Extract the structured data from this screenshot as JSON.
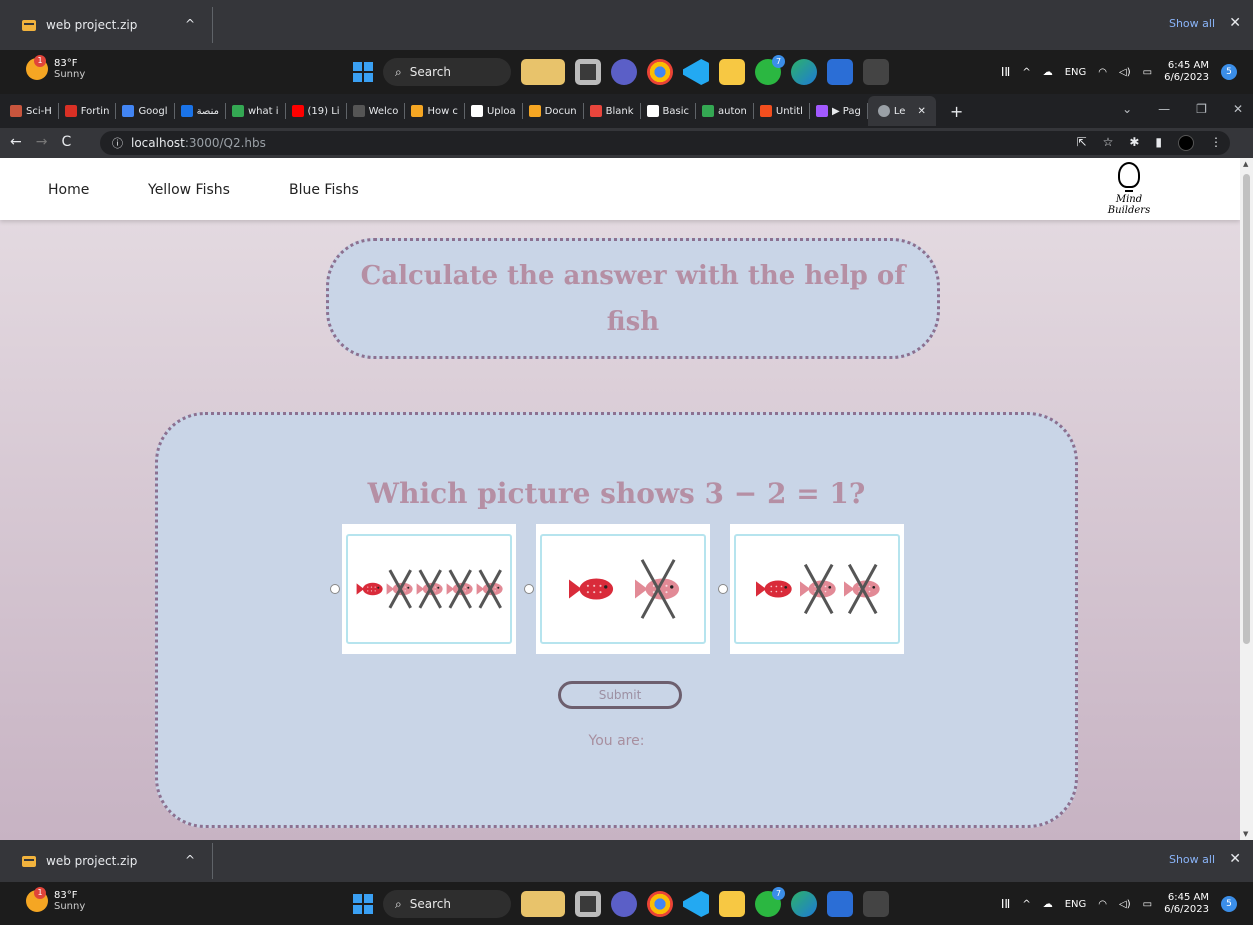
{
  "download_bar": {
    "filename": "web project.zip",
    "show_all": "Show all",
    "close": "✕",
    "chevron": "^"
  },
  "taskbar": {
    "weather_temp": "83°F",
    "weather_desc": "Sunny",
    "weather_badge": "1",
    "search_label": "Search",
    "lang": "ENG",
    "time": "6:45 AM",
    "date": "6/6/2023",
    "notifications": "5",
    "whatsapp_badge": "7"
  },
  "browser": {
    "tabs": [
      {
        "label": "Sci-H",
        "color": "#c8553d"
      },
      {
        "label": "Fortin",
        "color": "#d93025"
      },
      {
        "label": "Googl",
        "color": "#4285f4"
      },
      {
        "label": "منصة",
        "color": "#1a73e8"
      },
      {
        "label": "what i",
        "color": "#34a853"
      },
      {
        "label": "(19) Li",
        "color": "#ff0000"
      },
      {
        "label": "Welco",
        "color": "#555555"
      },
      {
        "label": "How c",
        "color": "#f5a623"
      },
      {
        "label": "Uploa",
        "color": "#ffffff"
      },
      {
        "label": "Docun",
        "color": "#f5a623"
      },
      {
        "label": "Blank",
        "color": "#e8453c"
      },
      {
        "label": "Basic",
        "color": "#ffffff"
      },
      {
        "label": "auton",
        "color": "#34a853"
      },
      {
        "label": "Untitl",
        "color": "#f24e1e"
      },
      {
        "label": "▶ Pag",
        "color": "#a259ff"
      }
    ],
    "active_tab": "Le",
    "new_tab": "+",
    "url_host": "localhost",
    "url_path": ":3000/Q2.hbs"
  },
  "site": {
    "nav": [
      "Home",
      "Yellow Fishs",
      "Blue Fishs"
    ],
    "logo_text": "Mind Builders"
  },
  "quiz": {
    "title": "Calculate the answer with the help of fish",
    "question": "Which picture shows 3 − 2 = 1?",
    "options": [
      {
        "total": 5,
        "crossed": 4
      },
      {
        "total": 2,
        "crossed": 1
      },
      {
        "total": 3,
        "crossed": 2
      }
    ],
    "submit_label": "Submit",
    "result_label": "You are:"
  },
  "colors": {
    "title_text": "#b58fa4",
    "panel_bg": "#c9d5e7",
    "dotted_border": "#8c7090",
    "fish_red": "#d92b3a",
    "fish_pink": "#e28a96"
  }
}
